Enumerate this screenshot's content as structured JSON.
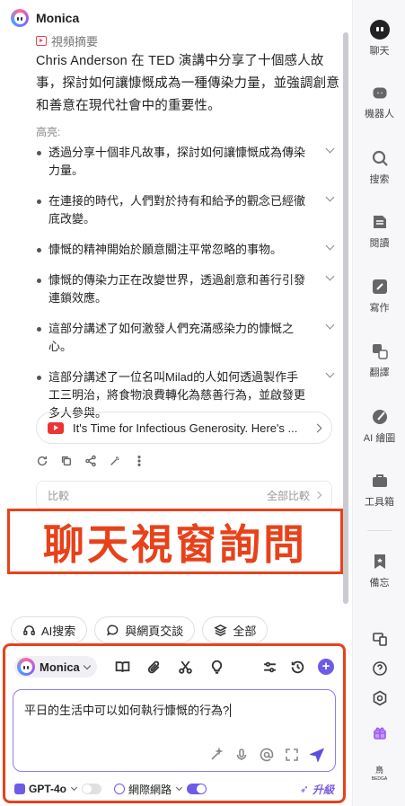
{
  "header": {
    "app_name": "Monica"
  },
  "video": {
    "label": "視頻摘要",
    "summary": "Chris Anderson 在 TED 演講中分享了十個感人故事，探討如何讓慷慨成為一種傳染力量，並強調創意和善意在現代社會中的重要性。",
    "highlights_label": "高亮:",
    "highlights": [
      "透過分享十個非凡故事，探討如何讓慷慨成為傳染力量。",
      "在連接的時代，人們對於持有和給予的觀念已經徹底改變。",
      "慷慨的精神開始於願意關注平常忽略的事物。",
      "慷慨的傳染力正在改變世界，透過創意和善行引發連鎖效應。",
      "這部分講述了如何激發人們充滿感染力的慷慨之心。",
      "這部分講述了一位名叫Milad的人如何透過製作手工三明治，將食物浪費轉化為慈善行為，並啟發更多人參與。"
    ],
    "source_title": "It's Time for Infectious Generosity. Here's ...",
    "compare_label": "比較",
    "compare_all": "全部比較"
  },
  "banner": {
    "text": "聊天視窗詢問"
  },
  "chips": {
    "ai_search": "AI搜索",
    "chat_web": "與網頁交談",
    "all": "全部"
  },
  "composer": {
    "model": "Monica",
    "input_value": "平日的生活中可以如何執行慷慨的行為?",
    "gpt_model": "GPT-4o",
    "web_label": "網際網路",
    "upgrade": "升級"
  },
  "rail": {
    "items": [
      "聊天",
      "機器人",
      "搜索",
      "閱讀",
      "寫作",
      "翻譯",
      "AI 繪圖",
      "工具箱",
      "備忘"
    ],
    "mini_label": "鳥",
    "mini_sub": "BEDGA"
  },
  "colors": {
    "accent": "#6c5ce7",
    "annotation": "#e8421a"
  }
}
